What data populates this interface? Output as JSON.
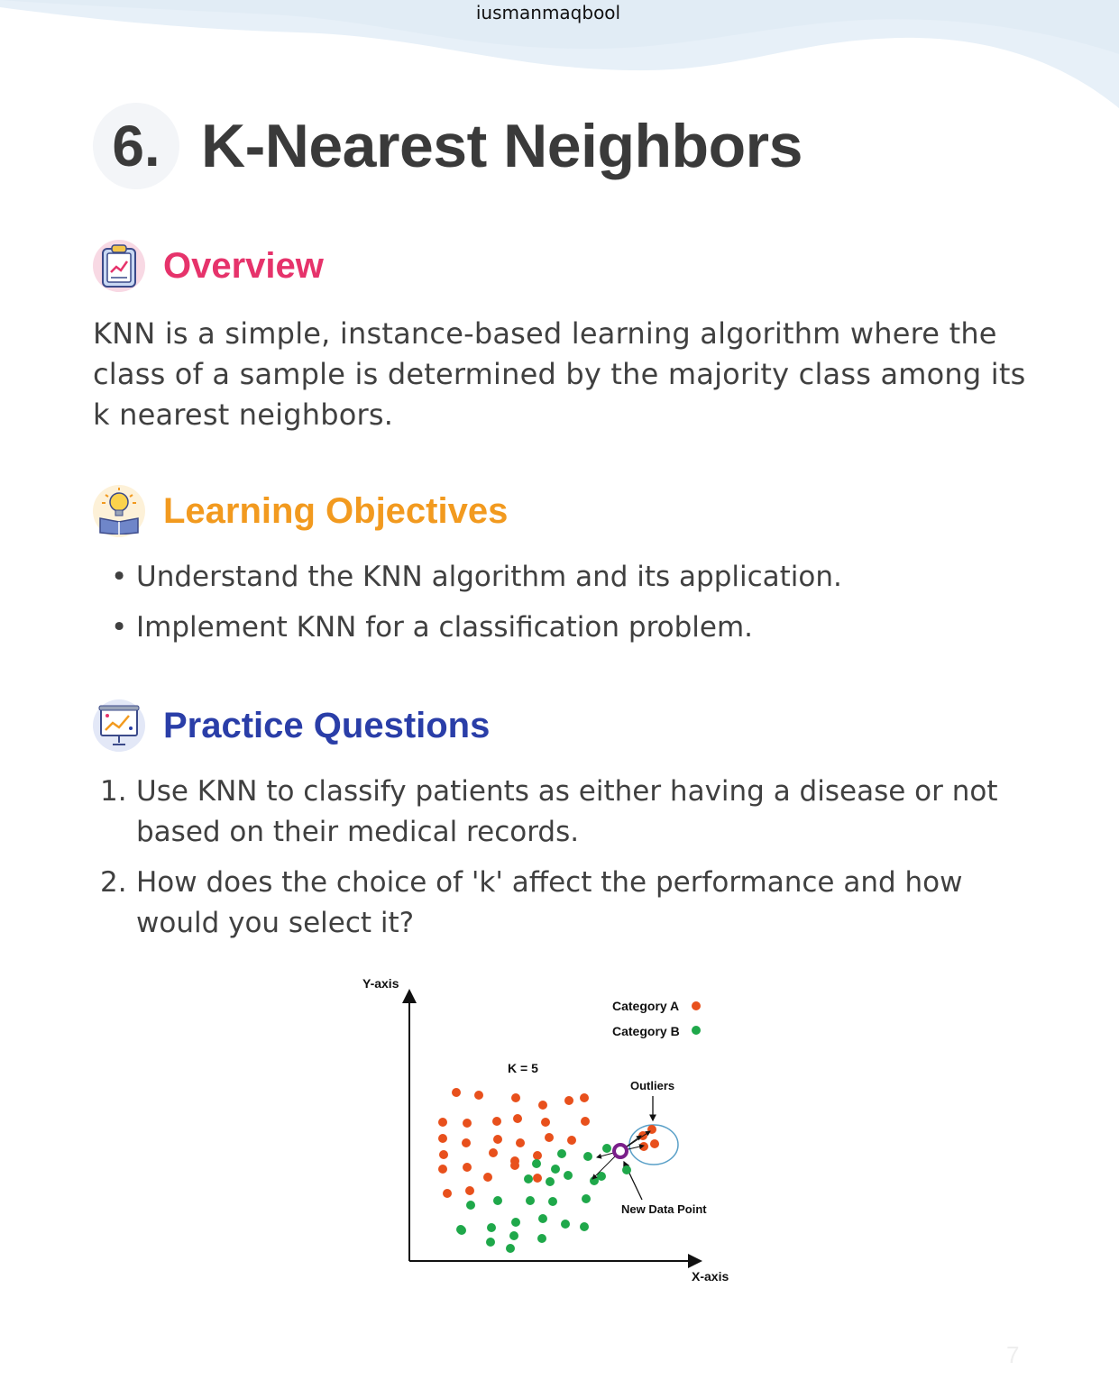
{
  "watermark": "iusmanmaqbool",
  "title": {
    "number": "6.",
    "text": "K-Nearest Neighbors"
  },
  "overview": {
    "icon": "clipboard-icon",
    "heading": "Overview",
    "color": "#e6336b",
    "body": "KNN is a simple, instance-based learning algorithm where the class of a sample is determined by the majority class among its k nearest neighbors."
  },
  "objectives": {
    "icon": "lightbulb-book-icon",
    "heading": "Learning Objectives",
    "color": "#f29a1f",
    "items": [
      {
        "marker": "•",
        "text": "Understand the KNN algorithm and its application."
      },
      {
        "marker": "•",
        "text": "Implement KNN for a classification problem."
      }
    ]
  },
  "practice": {
    "icon": "presentation-board-icon",
    "heading": "Practice Questions",
    "color": "#2a3ea8",
    "items": [
      {
        "marker": "1.",
        "text": "Use KNN to classify patients as either having a disease or not based on their medical records."
      },
      {
        "marker": "2.",
        "text": "How does the choice of 'k' affect the performance and how would you select it?"
      }
    ]
  },
  "diagram": {
    "y_axis_label": "Y-axis",
    "x_axis_label": "X-axis",
    "k_label": "K = 5",
    "legend": [
      {
        "label": "Category A",
        "color": "#e8501c"
      },
      {
        "label": "Category B",
        "color": "#1fa84a"
      }
    ],
    "outliers_label": "Outliers",
    "new_point_label": "New Data Point"
  },
  "page_number": "7"
}
